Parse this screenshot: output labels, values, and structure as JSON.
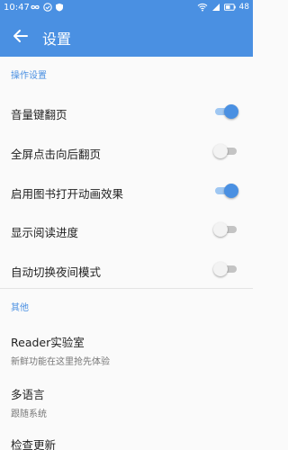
{
  "status_bar": {
    "time": "10:47",
    "battery": "48"
  },
  "app_bar": {
    "title": "设置"
  },
  "sections": {
    "operation": {
      "header": "操作设置",
      "items": [
        {
          "label": "音量键翻页",
          "enabled": true
        },
        {
          "label": "全屏点击向后翻页",
          "enabled": false
        },
        {
          "label": "启用图书打开动画效果",
          "enabled": true
        },
        {
          "label": "显示阅读进度",
          "enabled": false
        },
        {
          "label": "自动切换夜间模式",
          "enabled": false
        }
      ]
    },
    "other": {
      "header": "其他",
      "items": [
        {
          "label": "Reader实验室",
          "sub": "新鲜功能在这里抢先体验"
        },
        {
          "label": "多语言",
          "sub": "跟随系统"
        },
        {
          "label": "检查更新"
        }
      ]
    }
  },
  "colors": {
    "primary": "#4A90E2",
    "toggle_on_track": "#9fc7f2",
    "toggle_off_track": "#c4c4c4"
  }
}
